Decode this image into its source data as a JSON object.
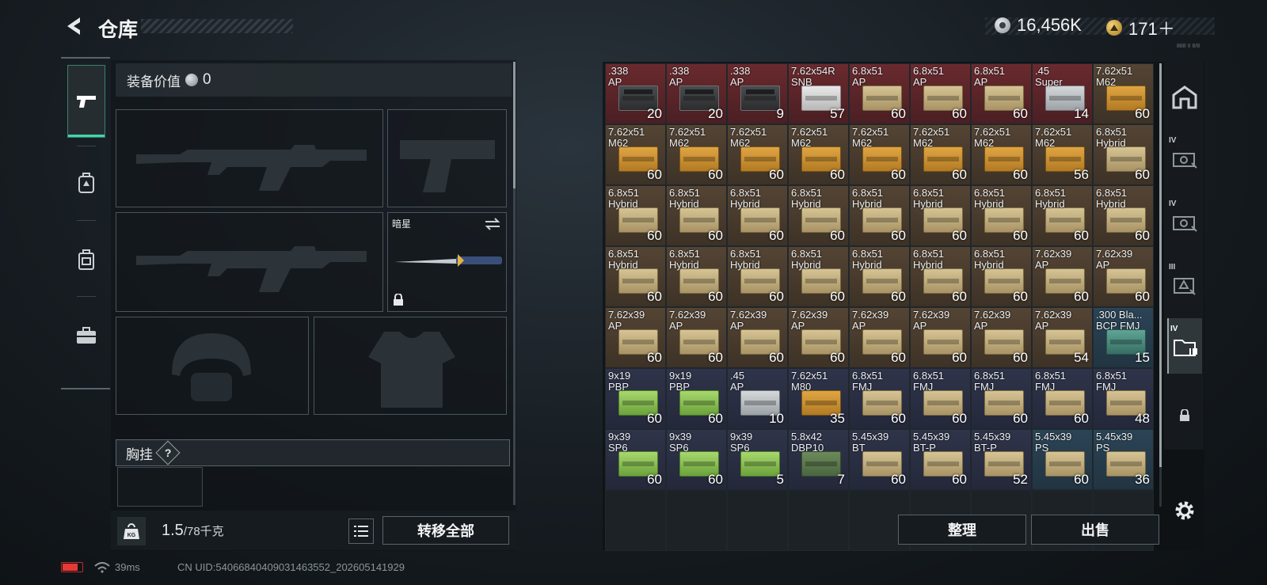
{
  "header": {
    "title": "仓库",
    "currency_silver": "16,456K",
    "currency_gold": "171＋",
    "tiny_code": "888 II 8/8"
  },
  "loadout": {
    "value_label": "装备价值",
    "value": "0",
    "secondary_label": "暗星",
    "chest_label": "胸挂",
    "chest_hint": "?"
  },
  "footer_left": {
    "weight_current": "1.5",
    "weight_max": "/78千克",
    "transfer_all": "转移全部"
  },
  "actions": {
    "organize": "整理",
    "sell": "出售"
  },
  "right_rail": {
    "tier_labels": [
      "IV",
      "IV",
      "III",
      "IV"
    ]
  },
  "status": {
    "ping": "39ms",
    "uid": "CN UID:5406684040903146355​2_202605141929"
  },
  "colors": {
    "accent": "#3fd6a8",
    "red_tier": "#6a2a2e",
    "brown_tier": "#544434",
    "navy_tier": "#30344a",
    "blue_tier": "#2b4456"
  },
  "inventory": [
    {
      "name": ".338\nAP",
      "qty": "20",
      "bg": "red",
      "icon": "ammo-can"
    },
    {
      "name": ".338\nAP",
      "qty": "20",
      "bg": "red",
      "icon": "ammo-can"
    },
    {
      "name": ".338\nAP",
      "qty": "9",
      "bg": "red",
      "icon": "ammo-can"
    },
    {
      "name": "7.62x54R\nSNB",
      "qty": "57",
      "bg": "red",
      "icon": "white"
    },
    {
      "name": "6.8x51\nAP",
      "qty": "60",
      "bg": "red",
      "icon": "tan"
    },
    {
      "name": "6.8x51\nAP",
      "qty": "60",
      "bg": "red",
      "icon": "tan"
    },
    {
      "name": "6.8x51\nAP",
      "qty": "60",
      "bg": "red",
      "icon": "tan"
    },
    {
      "name": ".45\nSuper",
      "qty": "14",
      "bg": "red",
      "icon": "silver"
    },
    {
      "name": "7.62x51\nM62",
      "qty": "60",
      "bg": "brown",
      "icon": "ochre"
    },
    {
      "name": "7.62x51\nM62",
      "qty": "60",
      "bg": "brown",
      "icon": "ochre"
    },
    {
      "name": "7.62x51\nM62",
      "qty": "60",
      "bg": "brown",
      "icon": "ochre"
    },
    {
      "name": "7.62x51\nM62",
      "qty": "60",
      "bg": "brown",
      "icon": "ochre"
    },
    {
      "name": "7.62x51\nM62",
      "qty": "60",
      "bg": "brown",
      "icon": "ochre"
    },
    {
      "name": "7.62x51\nM62",
      "qty": "60",
      "bg": "brown",
      "icon": "ochre"
    },
    {
      "name": "7.62x51\nM62",
      "qty": "60",
      "bg": "brown",
      "icon": "ochre"
    },
    {
      "name": "7.62x51\nM62",
      "qty": "60",
      "bg": "brown",
      "icon": "ochre"
    },
    {
      "name": "7.62x51\nM62",
      "qty": "56",
      "bg": "brown",
      "icon": "ochre"
    },
    {
      "name": "6.8x51\nHybrid",
      "qty": "60",
      "bg": "brown",
      "icon": "tan"
    },
    {
      "name": "6.8x51\nHybrid",
      "qty": "60",
      "bg": "brown",
      "icon": "tan"
    },
    {
      "name": "6.8x51\nHybrid",
      "qty": "60",
      "bg": "brown",
      "icon": "tan"
    },
    {
      "name": "6.8x51\nHybrid",
      "qty": "60",
      "bg": "brown",
      "icon": "tan"
    },
    {
      "name": "6.8x51\nHybrid",
      "qty": "60",
      "bg": "brown",
      "icon": "tan"
    },
    {
      "name": "6.8x51\nHybrid",
      "qty": "60",
      "bg": "brown",
      "icon": "tan"
    },
    {
      "name": "6.8x51\nHybrid",
      "qty": "60",
      "bg": "brown",
      "icon": "tan"
    },
    {
      "name": "6.8x51\nHybrid",
      "qty": "60",
      "bg": "brown",
      "icon": "tan"
    },
    {
      "name": "6.8x51\nHybrid",
      "qty": "60",
      "bg": "brown",
      "icon": "tan"
    },
    {
      "name": "6.8x51\nHybrid",
      "qty": "60",
      "bg": "brown",
      "icon": "tan"
    },
    {
      "name": "6.8x51\nHybrid",
      "qty": "60",
      "bg": "brown",
      "icon": "tan"
    },
    {
      "name": "6.8x51\nHybrid",
      "qty": "60",
      "bg": "brown",
      "icon": "tan"
    },
    {
      "name": "6.8x51\nHybrid",
      "qty": "60",
      "bg": "brown",
      "icon": "tan"
    },
    {
      "name": "6.8x51\nHybrid",
      "qty": "60",
      "bg": "brown",
      "icon": "tan"
    },
    {
      "name": "6.8x51\nHybrid",
      "qty": "60",
      "bg": "brown",
      "icon": "tan"
    },
    {
      "name": "6.8x51\nHybrid",
      "qty": "60",
      "bg": "brown",
      "icon": "tan"
    },
    {
      "name": "6.8x51\nHybrid",
      "qty": "60",
      "bg": "brown",
      "icon": "tan"
    },
    {
      "name": "7.62x39\nAP",
      "qty": "60",
      "bg": "brown",
      "icon": "tan"
    },
    {
      "name": "7.62x39\nAP",
      "qty": "60",
      "bg": "brown",
      "icon": "tan"
    },
    {
      "name": "7.62x39\nAP",
      "qty": "60",
      "bg": "brown",
      "icon": "tan"
    },
    {
      "name": "7.62x39\nAP",
      "qty": "60",
      "bg": "brown",
      "icon": "tan"
    },
    {
      "name": "7.62x39\nAP",
      "qty": "60",
      "bg": "brown",
      "icon": "tan"
    },
    {
      "name": "7.62x39\nAP",
      "qty": "60",
      "bg": "brown",
      "icon": "tan"
    },
    {
      "name": "7.62x39\nAP",
      "qty": "60",
      "bg": "brown",
      "icon": "tan"
    },
    {
      "name": "7.62x39\nAP",
      "qty": "60",
      "bg": "brown",
      "icon": "tan"
    },
    {
      "name": "7.62x39\nAP",
      "qty": "60",
      "bg": "brown",
      "icon": "tan"
    },
    {
      "name": "7.62x39\nAP",
      "qty": "54",
      "bg": "brown",
      "icon": "tan"
    },
    {
      "name": ".300 Bla...\nBCP FMJ",
      "qty": "15",
      "bg": "blue",
      "icon": "teal"
    },
    {
      "name": "9x19\nPBP",
      "qty": "60",
      "bg": "navy",
      "icon": "green"
    },
    {
      "name": "9x19\nPBP",
      "qty": "60",
      "bg": "navy",
      "icon": "green"
    },
    {
      "name": ".45\nAP",
      "qty": "10",
      "bg": "navy",
      "icon": "silver"
    },
    {
      "name": "7.62x51\nM80",
      "qty": "35",
      "bg": "navy",
      "icon": "ochre"
    },
    {
      "name": "6.8x51\nFMJ",
      "qty": "60",
      "bg": "navy",
      "icon": "tan"
    },
    {
      "name": "6.8x51\nFMJ",
      "qty": "60",
      "bg": "navy",
      "icon": "tan"
    },
    {
      "name": "6.8x51\nFMJ",
      "qty": "60",
      "bg": "navy",
      "icon": "tan"
    },
    {
      "name": "6.8x51\nFMJ",
      "qty": "60",
      "bg": "navy",
      "icon": "tan"
    },
    {
      "name": "6.8x51\nFMJ",
      "qty": "48",
      "bg": "navy",
      "icon": "tan"
    },
    {
      "name": "9x39\nSP6",
      "qty": "60",
      "bg": "navy",
      "icon": "green"
    },
    {
      "name": "9x39\nSP6",
      "qty": "60",
      "bg": "navy",
      "icon": "green"
    },
    {
      "name": "9x39\nSP6",
      "qty": "5",
      "bg": "navy",
      "icon": "green"
    },
    {
      "name": "5.8x42\nDBP10",
      "qty": "7",
      "bg": "navy",
      "icon": "olive"
    },
    {
      "name": "5.45x39\nBT",
      "qty": "60",
      "bg": "navy",
      "icon": "tan"
    },
    {
      "name": "5.45x39\nBT-P",
      "qty": "60",
      "bg": "navy",
      "icon": "tan"
    },
    {
      "name": "5.45x39\nBT-P",
      "qty": "52",
      "bg": "navy",
      "icon": "tan"
    },
    {
      "name": "5.45x39\nPS",
      "qty": "60",
      "bg": "blue",
      "icon": "tan"
    },
    {
      "name": "5.45x39\nPS",
      "qty": "36",
      "bg": "blue",
      "icon": "tan"
    },
    {
      "name": "",
      "qty": "",
      "bg": "empty",
      "icon": ""
    },
    {
      "name": "",
      "qty": "",
      "bg": "empty",
      "icon": ""
    },
    {
      "name": "",
      "qty": "",
      "bg": "empty",
      "icon": ""
    },
    {
      "name": "",
      "qty": "",
      "bg": "empty",
      "icon": ""
    },
    {
      "name": "",
      "qty": "",
      "bg": "empty",
      "icon": ""
    },
    {
      "name": "",
      "qty": "",
      "bg": "empty",
      "icon": ""
    },
    {
      "name": "",
      "qty": "",
      "bg": "empty",
      "icon": ""
    },
    {
      "name": "",
      "qty": "",
      "bg": "empty",
      "icon": ""
    },
    {
      "name": "",
      "qty": "",
      "bg": "empty",
      "icon": ""
    }
  ]
}
